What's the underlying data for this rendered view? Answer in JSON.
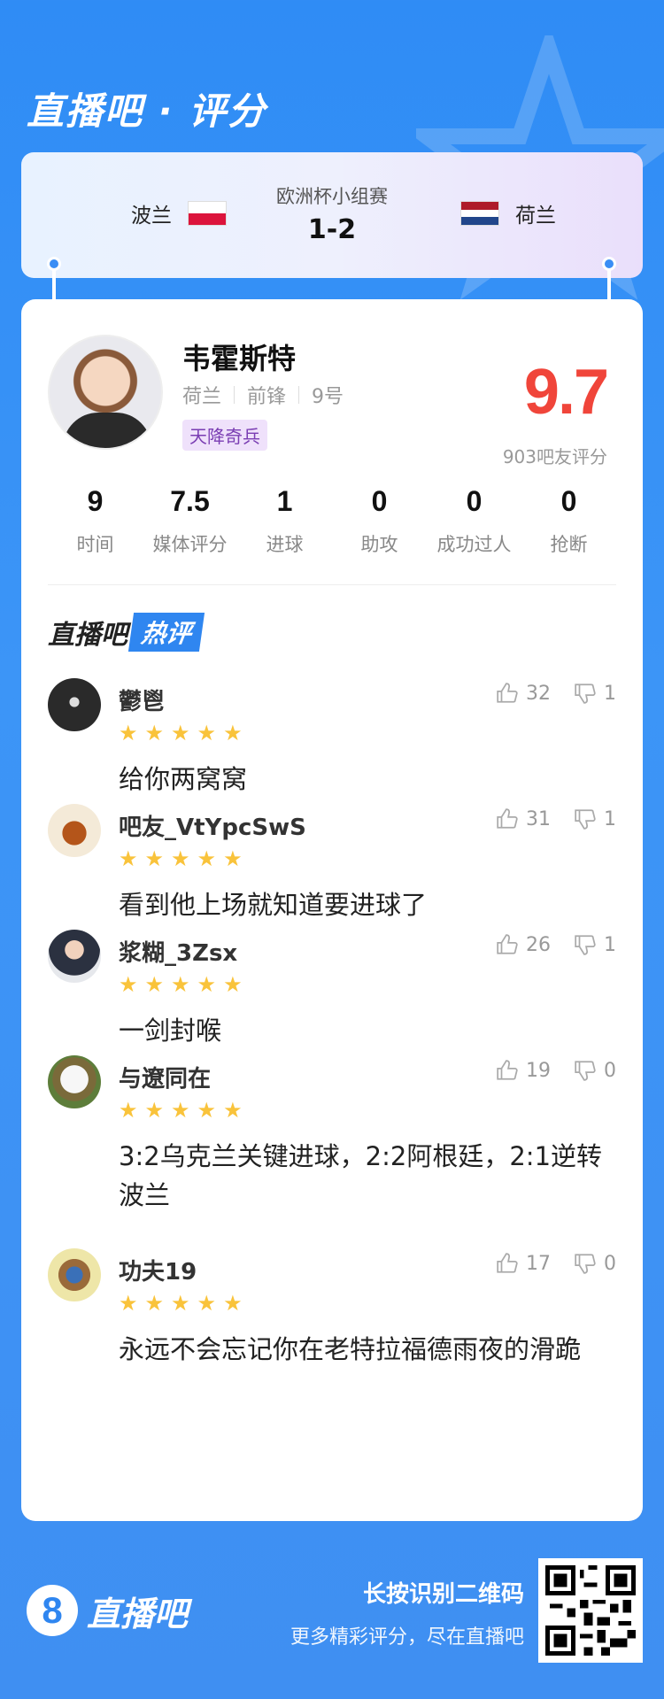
{
  "brand": {
    "title": "直播吧 · 评分"
  },
  "match": {
    "competition": "欧洲杯小组赛",
    "score": "1-2",
    "home": {
      "name": "波兰",
      "flag_colors": [
        "#ffffff",
        "#dc143c"
      ]
    },
    "away": {
      "name": "荷兰",
      "flag_colors": [
        "#ae1c28",
        "#ffffff",
        "#21468b"
      ]
    }
  },
  "player": {
    "name": "韦霍斯特",
    "team": "荷兰",
    "position": "前锋",
    "number": "9号",
    "tag": "天降奇兵",
    "rating": "9.7",
    "rating_count": "903吧友评分"
  },
  "stats": [
    {
      "value": "9",
      "label": "时间"
    },
    {
      "value": "7.5",
      "label": "媒体评分"
    },
    {
      "value": "1",
      "label": "进球"
    },
    {
      "value": "0",
      "label": "助攻"
    },
    {
      "value": "0",
      "label": "成功过人"
    },
    {
      "value": "0",
      "label": "抢断"
    }
  ],
  "hot": {
    "prefix": "直播吧",
    "highlight": "热评"
  },
  "comments": [
    {
      "name": "鬱鬯",
      "stars": 5,
      "likes": "32",
      "dislikes": "1",
      "text": "给你两窝窝"
    },
    {
      "name": "吧友_VtYpcSwS",
      "stars": 5,
      "likes": "31",
      "dislikes": "1",
      "text": "看到他上场就知道要进球了"
    },
    {
      "name": "浆糊_3Zsx",
      "stars": 5,
      "likes": "26",
      "dislikes": "1",
      "text": "一剑封喉"
    },
    {
      "name": "与遼同在",
      "stars": 5,
      "likes": "19",
      "dislikes": "0",
      "text": "3:2乌克兰关键进球，2:2阿根廷，2:1逆转波兰"
    },
    {
      "name": "功夫19",
      "stars": 5,
      "likes": "17",
      "dislikes": "0",
      "text": "永远不会忘记你在老特拉福德雨夜的滑跪"
    }
  ],
  "footer": {
    "logo_number": "8",
    "logo_text": "直播吧",
    "cta_title": "长按识别二维码",
    "cta_sub": "更多精彩评分，尽在直播吧"
  }
}
